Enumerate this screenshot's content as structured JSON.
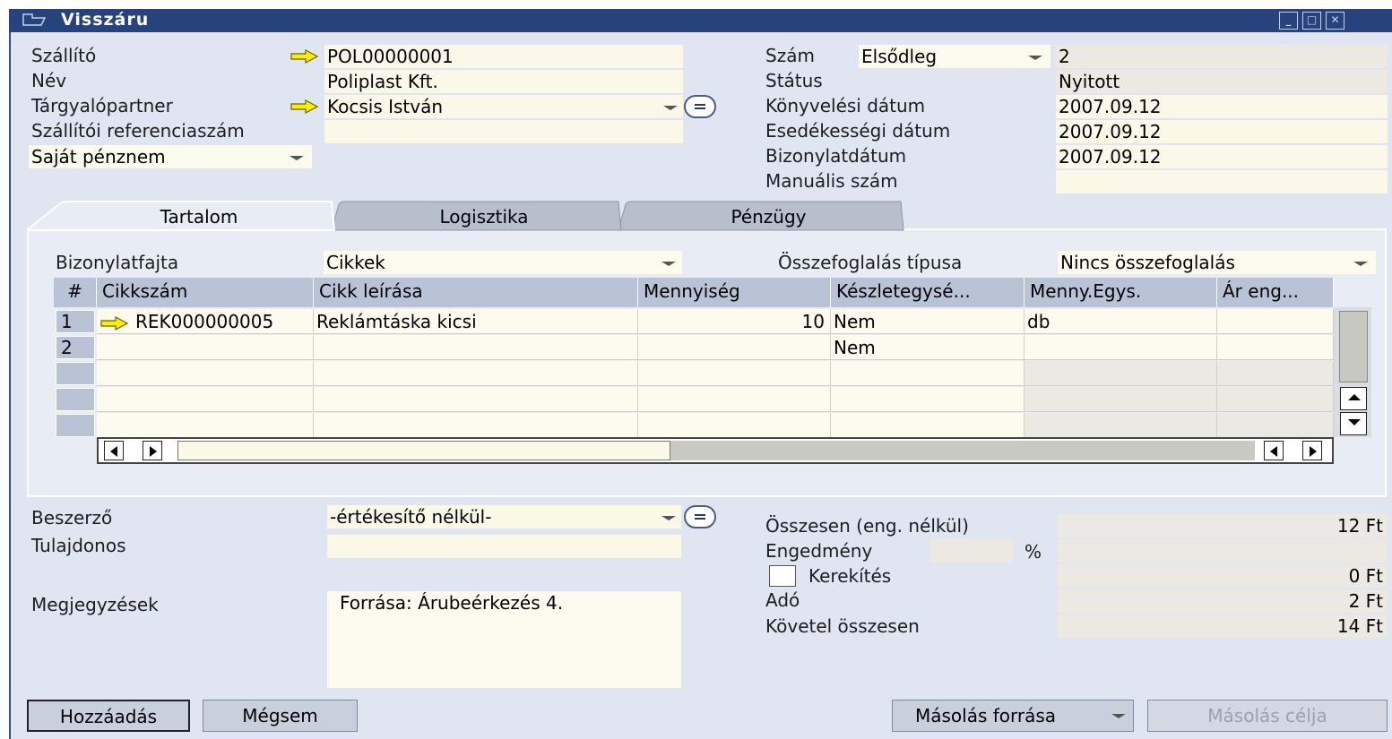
{
  "window": {
    "title": "Visszáru"
  },
  "header_left": {
    "supplier_label": "Szállító",
    "supplier_value": "POL00000001",
    "name_label": "Név",
    "name_value": "Poliplast Kft.",
    "contact_label": "Tárgyalópartner",
    "contact_value": "Kocsis István",
    "supplier_ref_label": "Szállítói referenciaszám",
    "supplier_ref_value": "",
    "currency_select": "Saját pénznem"
  },
  "header_right": {
    "number_label": "Szám",
    "number_series": "Elsődleg",
    "number_value": "2",
    "status_label": "Státus",
    "status_value": "Nyitott",
    "posting_date_label": "Könyvelési dátum",
    "posting_date_value": "2007.09.12",
    "due_date_label": "Esedékességi dátum",
    "due_date_value": "2007.09.12",
    "document_date_label": "Bizonylatdátum",
    "document_date_value": "2007.09.12",
    "manual_number_label": "Manuális szám",
    "manual_number_value": ""
  },
  "tabs": [
    {
      "label": "Tartalom",
      "active": true
    },
    {
      "label": "Logisztika",
      "active": false
    },
    {
      "label": "Pénzügy",
      "active": false
    }
  ],
  "content": {
    "doc_type_label": "Bizonylatfajta",
    "doc_type_value": "Cikkek",
    "summary_type_label": "Összefoglalás típusa",
    "summary_type_value": "Nincs összefoglalás",
    "columns": [
      "#",
      "Cikkszám",
      "Cikk leírása",
      "Mennyiség",
      "Készletegysé...",
      "Menny.Egys.",
      "Ár eng..."
    ],
    "rows": [
      {
        "num": "1",
        "item_code": "REK000000005",
        "description": "Reklámtáska kicsi",
        "quantity": "10",
        "inventory_unit": "Nem",
        "unit": "db",
        "price": ""
      },
      {
        "num": "2",
        "item_code": "",
        "description": "",
        "quantity": "",
        "inventory_unit": "Nem",
        "unit": "",
        "price": ""
      },
      {
        "num": "",
        "item_code": "",
        "description": "",
        "quantity": "",
        "inventory_unit": "",
        "unit": "",
        "price": ""
      },
      {
        "num": "",
        "item_code": "",
        "description": "",
        "quantity": "",
        "inventory_unit": "",
        "unit": "",
        "price": ""
      },
      {
        "num": "",
        "item_code": "",
        "description": "",
        "quantity": "",
        "inventory_unit": "",
        "unit": "",
        "price": ""
      }
    ]
  },
  "footer_left": {
    "buyer_label": "Beszerző",
    "buyer_value": "-értékesítő nélkül-",
    "owner_label": "Tulajdonos",
    "owner_value": "",
    "notes_label": "Megjegyzések",
    "notes_value": "Forrása: Árubeérkezés 4."
  },
  "totals": {
    "total_before_discount_label": "Összesen (eng. nélkül)",
    "total_before_discount_value": "12 Ft",
    "discount_label": "Engedmény",
    "discount_percent_value": "",
    "discount_percent_sign": "%",
    "discount_value": "",
    "rounding_label": "Kerekítés",
    "rounding_checked": false,
    "rounding_value": "0 Ft",
    "tax_label": "Adó",
    "tax_value": "2 Ft",
    "total_label": "Követel összesen",
    "total_value": "14 Ft"
  },
  "buttons": {
    "add": "Hozzáadás",
    "cancel": "Mégsem",
    "copy_from": "Másolás forrása",
    "copy_to": "Másolás célja"
  },
  "colors": {
    "titlebar": "#27437e",
    "window_bg": "#dfe6f2",
    "field_bg": "#fcf8e8",
    "header_bg": "#b9c3d6",
    "arrow_yellow": "#ffee00"
  }
}
